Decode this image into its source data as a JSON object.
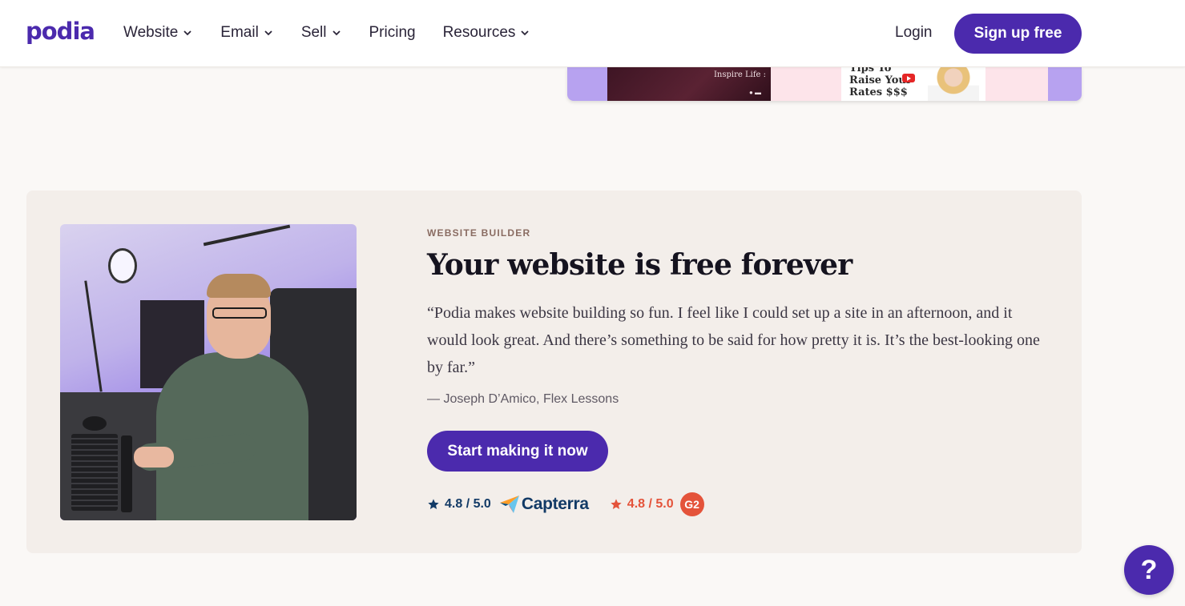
{
  "brand": {
    "logo": "podia",
    "accent": "#4b2aad"
  },
  "nav": {
    "items": [
      {
        "label": "Website",
        "has_dropdown": true
      },
      {
        "label": "Email",
        "has_dropdown": true
      },
      {
        "label": "Sell",
        "has_dropdown": true
      },
      {
        "label": "Pricing",
        "has_dropdown": false
      },
      {
        "label": "Resources",
        "has_dropdown": true
      }
    ],
    "login": "Login",
    "signup": "Sign up free"
  },
  "preview": {
    "dark_panel_text": "Inspire Life :",
    "card_text": "Tips To\nRaise Your\nRates $$$"
  },
  "feature": {
    "eyebrow": "WEBSITE BUILDER",
    "headline": "Your website is free forever",
    "quote": "“Podia makes website building so fun. I feel like I could set up a site in an afternoon, and it would look great. And there’s something to be said for how pretty it is. It’s the best-looking one by far.”",
    "attribution": "— Joseph D’Amico, Flex Lessons",
    "cta": "Start making it now",
    "ratings": [
      {
        "score": "4.8 / 5.0",
        "platform": "Capterra",
        "color": "#123a66",
        "icon": "star-icon"
      },
      {
        "score": "4.8 / 5.0",
        "platform": "G2",
        "color": "#e4533a",
        "icon": "star-icon"
      }
    ]
  },
  "help": {
    "label": "?"
  }
}
